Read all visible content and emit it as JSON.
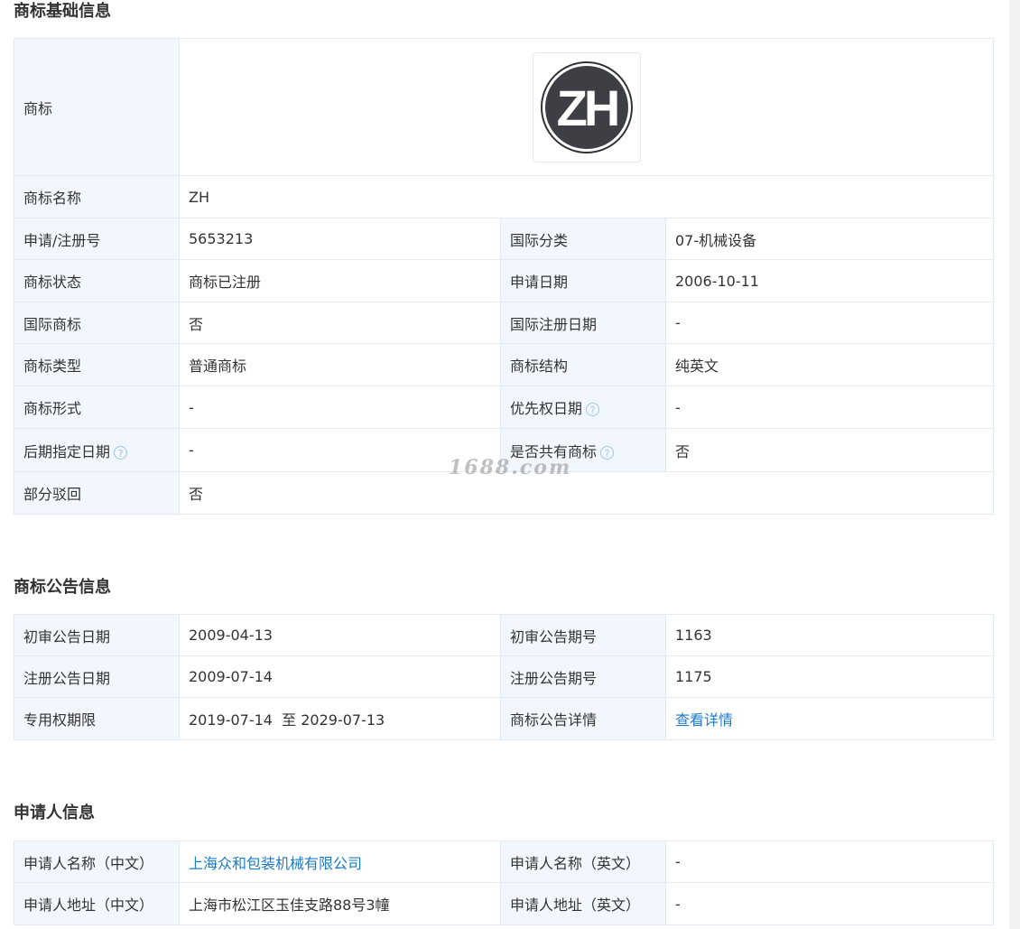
{
  "basic": {
    "title": "商标基础信息",
    "logo_label": "商标",
    "logo_text": "ZH",
    "name_label": "商标名称",
    "name_value": "ZH",
    "rows": [
      {
        "l1": "申请/注册号",
        "v1": "5653213",
        "l2": "国际分类",
        "v2": "07-机械设备"
      },
      {
        "l1": "商标状态",
        "v1": "商标已注册",
        "l2": "申请日期",
        "v2": "2006-10-11"
      },
      {
        "l1": "国际商标",
        "v1": "否",
        "l2": "国际注册日期",
        "v2": "-"
      },
      {
        "l1": "商标类型",
        "v1": "普通商标",
        "l2": "商标结构",
        "v2": "纯英文"
      },
      {
        "l1": "商标形式",
        "v1": "-",
        "l2": "优先权日期",
        "v2": "-"
      },
      {
        "l1": "后期指定日期",
        "v1": "-",
        "l2": "是否共有商标",
        "v2": "否"
      }
    ],
    "partial_label": "部分驳回",
    "partial_value": "否",
    "help_glyph": "?"
  },
  "announce": {
    "title": "商标公告信息",
    "rows": [
      {
        "l1": "初审公告日期",
        "v1": "2009-04-13",
        "l2": "初审公告期号",
        "v2": "1163"
      },
      {
        "l1": "注册公告日期",
        "v1": "2009-07-14",
        "l2": "注册公告期号",
        "v2": "1175"
      },
      {
        "l1": "专用权期限",
        "v1": "2019-07-14  至 2029-07-13",
        "l2": "商标公告详情",
        "v2": "查看详情"
      }
    ]
  },
  "applicant": {
    "title": "申请人信息",
    "rows": [
      {
        "l1": "申请人名称（中文）",
        "v1": "上海众和包装机械有限公司",
        "l2": "申请人名称（英文）",
        "v2": "-"
      },
      {
        "l1": "申请人地址（中文）",
        "v1": "上海市松江区玉佳支路88号3幢",
        "l2": "申请人地址（英文）",
        "v2": "-"
      }
    ]
  },
  "watermark": "1688.com",
  "colors": {
    "label_bg": "#f2f7fd",
    "border": "#e4eaf1",
    "link": "#1d7bc7"
  }
}
